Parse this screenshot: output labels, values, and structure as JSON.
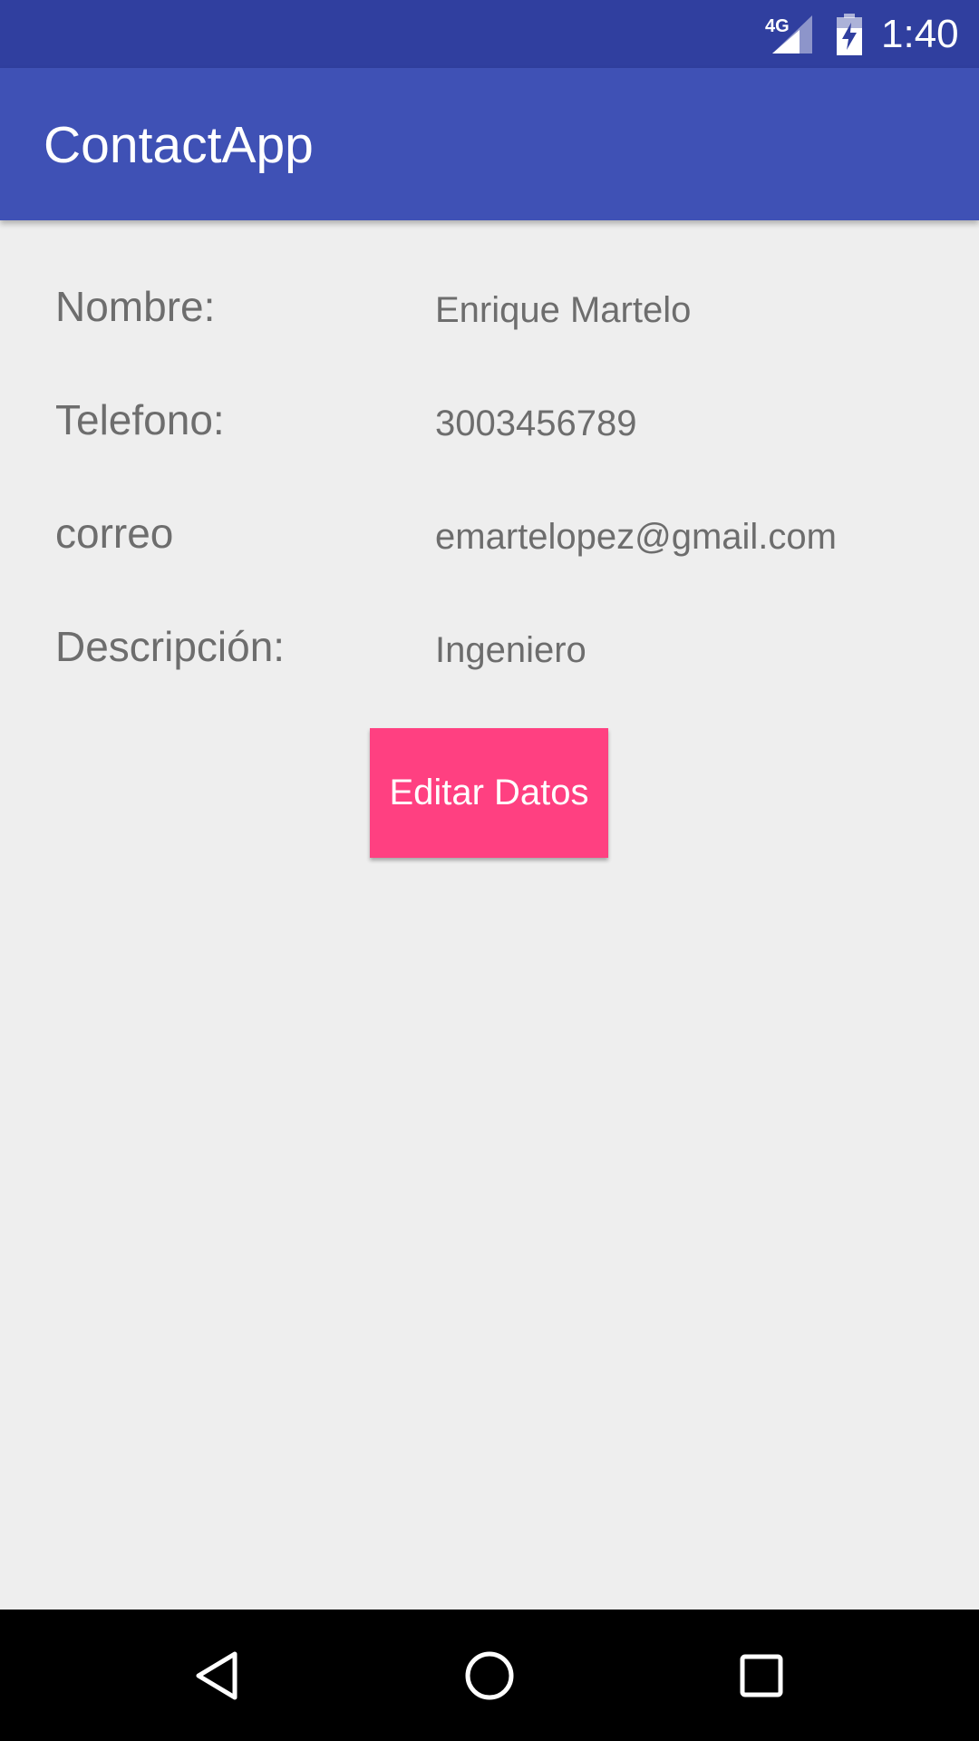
{
  "status_bar": {
    "network_label": "4G",
    "network_icon": "cell-signal-icon",
    "battery_icon": "battery-charging-icon",
    "time": "1:40"
  },
  "app_bar": {
    "title": "ContactApp"
  },
  "fields": [
    {
      "label": "Nombre:",
      "value": "Enrique Martelo"
    },
    {
      "label": "Telefono:",
      "value": "3003456789"
    },
    {
      "label": "correo",
      "value": "emartelopez@gmail.com"
    },
    {
      "label": "Descripción:",
      "value": "Ingeniero"
    }
  ],
  "actions": {
    "edit_label": "Editar Datos"
  },
  "nav_bar": {
    "back_icon": "back-triangle-icon",
    "home_icon": "home-circle-icon",
    "recents_icon": "recents-square-icon"
  },
  "colors": {
    "status_bar": "#303f9f",
    "app_bar": "#3f51b5",
    "accent": "#ff4081",
    "background": "#eeeeee",
    "text_secondary": "#6d6d6d"
  }
}
